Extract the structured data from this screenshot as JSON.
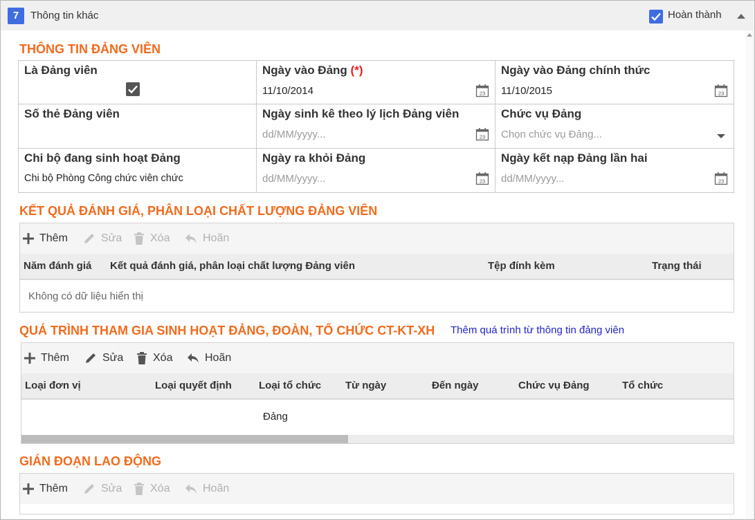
{
  "section": {
    "number": "7",
    "title": "Thông tin khác",
    "complete_label": "Hoàn thành",
    "complete_checked": true,
    "accent_color": "#3f6de0"
  },
  "party_info": {
    "heading": "THÔNG TIN ĐẢNG VIÊN",
    "is_member": {
      "label": "Là Đảng viên",
      "checked": true
    },
    "join_date": {
      "label": "Ngày vào Đảng",
      "required_mark": "(*)",
      "value": "11/10/2014"
    },
    "official_date": {
      "label": "Ngày vào Đảng chính thức",
      "value": "11/10/2015"
    },
    "card_number": {
      "label": "Số thẻ Đảng viên",
      "value": ""
    },
    "birth_date": {
      "label": "Ngày sinh kê theo lý lịch Đảng viên",
      "placeholder": "dd/MM/yyyy..."
    },
    "position": {
      "label": "Chức vụ Đảng",
      "placeholder": "Chọn chức vụ Đảng..."
    },
    "branch": {
      "label": "Chi bộ đang sinh hoạt Đảng",
      "value": "Chi bộ Phòng Công chức viên chức"
    },
    "leave_date": {
      "label": "Ngày ra khỏi Đảng",
      "placeholder": "dd/MM/yyyy..."
    },
    "rejoin_date": {
      "label": "Ngày kết nạp Đảng lần hai",
      "placeholder": "dd/MM/yyyy..."
    },
    "calendar_day": "23"
  },
  "evaluation": {
    "heading": "KẾT QUẢ ĐÁNH GIÁ, PHÂN LOẠI CHẤT LƯỢNG ĐẢNG VIÊN",
    "toolbar": {
      "add": "Thêm",
      "edit": "Sửa",
      "delete": "Xóa",
      "undo": "Hoãn"
    },
    "columns": [
      "Năm đánh giá",
      "Kết quả đánh giá, phân loại chất lượng Đảng viên",
      "Tệp đính kèm",
      "Trạng thái"
    ],
    "empty_text": "Không có dữ liệu hiển thị"
  },
  "participation": {
    "heading": "QUÁ TRÌNH THAM GIA SINH HOẠT ĐẢNG, ĐOÀN, TỔ CHỨC CT-KT-XH",
    "link_text": "Thêm quá trình từ thông tin đảng viên",
    "toolbar": {
      "add": "Thêm",
      "edit": "Sửa",
      "delete": "Xóa",
      "undo": "Hoãn"
    },
    "columns": [
      "Loại đơn vị",
      "Loại quyết định",
      "Loại tổ chức",
      "Từ ngày",
      "Đến ngày",
      "Chức vụ Đảng",
      "Tổ chức"
    ],
    "rows": [
      {
        "unit_type": "",
        "decision_type": "",
        "org_type": "Đảng",
        "from": "",
        "to": "",
        "position": "",
        "org": ""
      }
    ]
  },
  "interruption": {
    "heading": "GIÁN ĐOẠN LAO ĐỘNG",
    "toolbar": {
      "add": "Thêm",
      "edit": "Sửa",
      "delete": "Xóa",
      "undo": "Hoãn"
    }
  }
}
